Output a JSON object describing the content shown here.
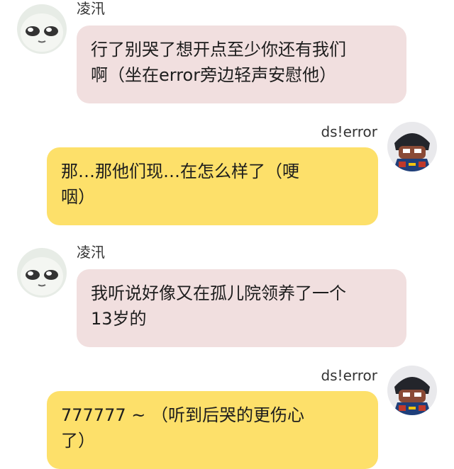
{
  "messages": [
    {
      "side": "left",
      "sender": "凌汛",
      "avatar_icon": "meme-face-icon",
      "text": "行了别哭了想开点至少你还有我们\n啊（坐在error旁边轻声安慰他）",
      "bubble_color": "#f1dfdf"
    },
    {
      "side": "right",
      "sender": "ds!error",
      "avatar_icon": "cartoon-character-avatar-icon",
      "text": "那…那他们现…在怎么样了（哽\n咽）",
      "bubble_color": "#fde06a"
    },
    {
      "side": "left",
      "sender": "凌汛",
      "avatar_icon": "meme-face-icon",
      "text": "我听说好像又在孤儿院领养了一个\n13岁的",
      "bubble_color": "#f1dfdf"
    },
    {
      "side": "right",
      "sender": "ds!error",
      "avatar_icon": "cartoon-character-avatar-icon",
      "text": "777777 ~ （听到后哭的更伤心\n了）",
      "bubble_color": "#fde06a"
    }
  ]
}
